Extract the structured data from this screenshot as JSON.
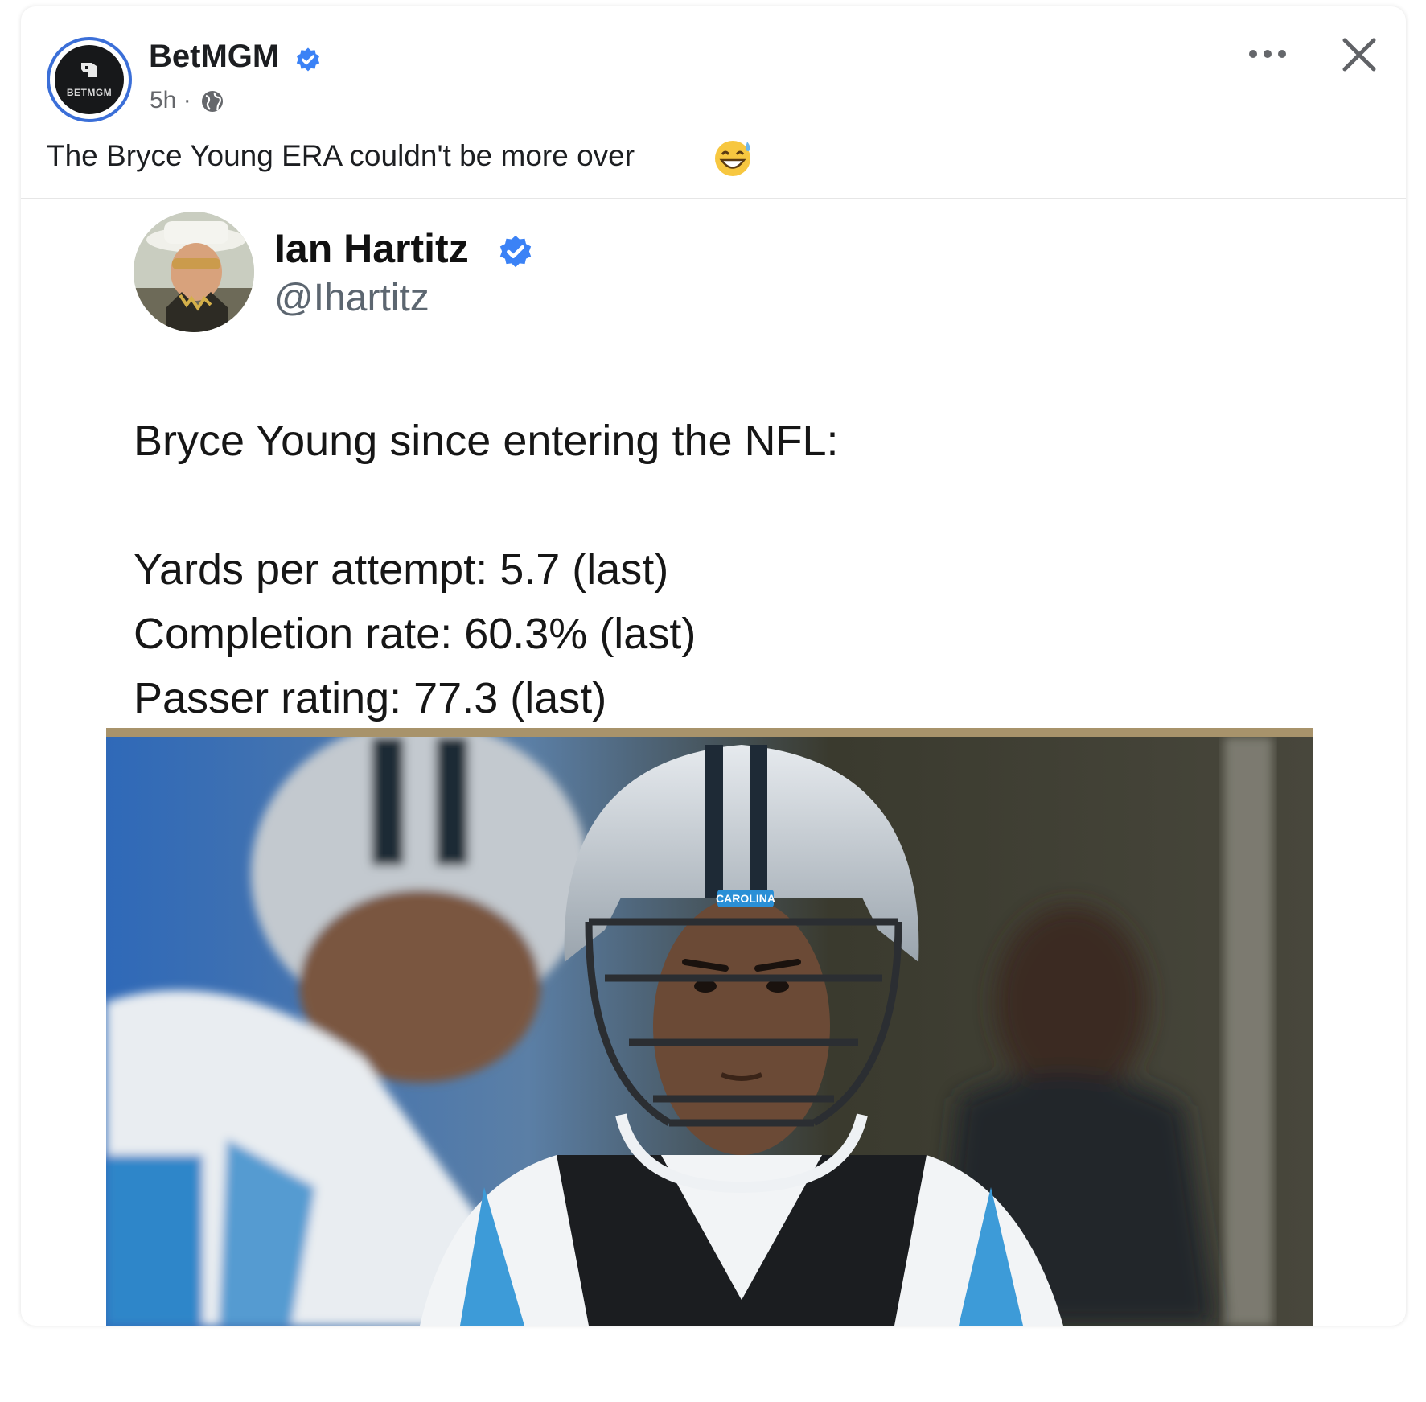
{
  "post": {
    "page_name": "BetMGM",
    "logo_text": "BETMGM",
    "time": "5h ·",
    "caption": "The Bryce Young ERA couldn't be more over"
  },
  "tweet": {
    "author_name": "Ian Hartitz",
    "handle": "@Ihartitz",
    "headline": "Bryce Young since entering the NFL:",
    "stats": [
      "Yards per attempt: 5.7 (last)",
      "Completion rate: 60.3% (last)",
      "Passer rating: 77.3 (last)"
    ]
  },
  "photo": {
    "helmet_text": "CAROLINA"
  },
  "colors": {
    "verified": "#3b82f6",
    "panthers_blue": "#0085ca",
    "gold_bar": "#a8936b"
  },
  "icons": [
    "verified-badge-icon",
    "globe-icon",
    "more-options-icon",
    "close-icon",
    "grinning-sweat-emoji-icon"
  ]
}
